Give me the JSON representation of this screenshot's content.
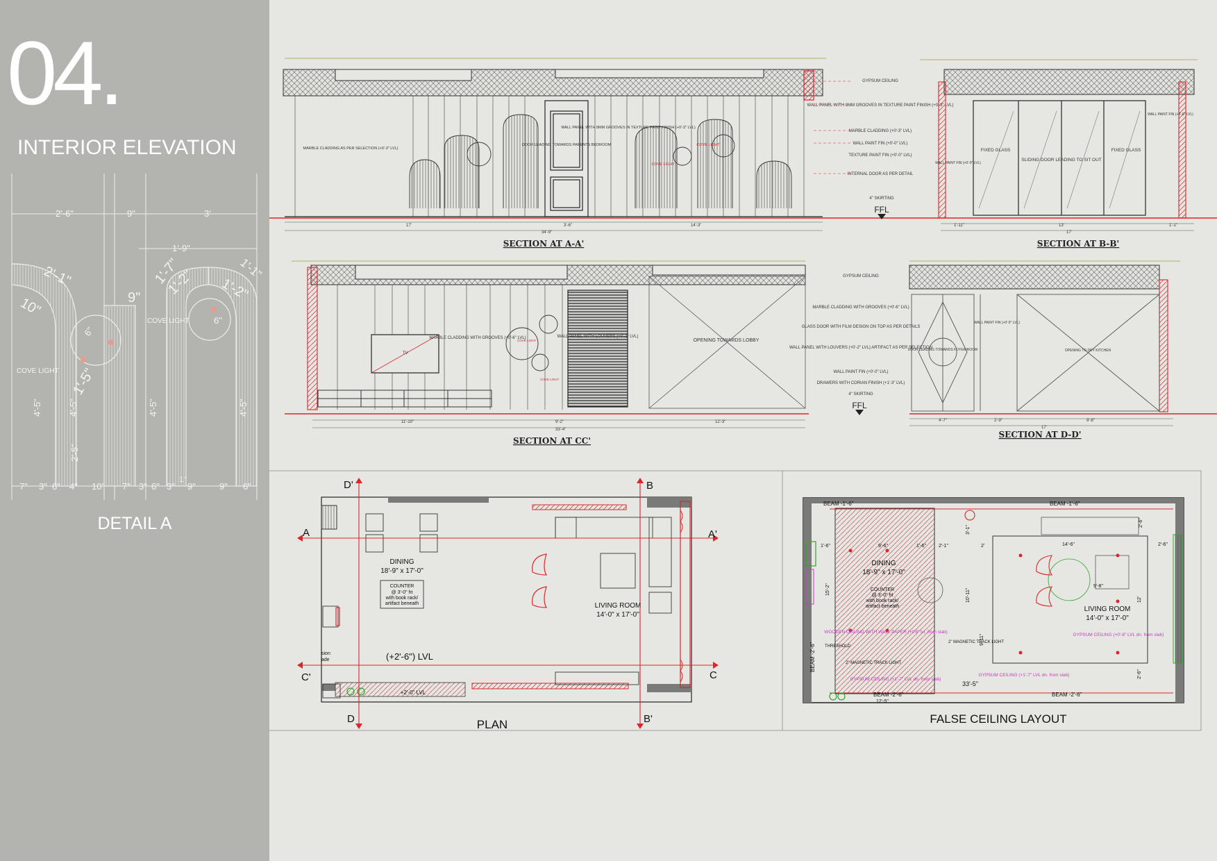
{
  "sheet": {
    "number": "04.",
    "title": "INTERIOR ELEVATION",
    "detail_title": "DETAIL A"
  },
  "detail_a": {
    "dims_top": [
      "2'-6\"",
      "9\"",
      "3'"
    ],
    "dims_radius": [
      "1'-9\"",
      "1'-1\"",
      "2'-1\"",
      "10\"",
      "9\"",
      "1'-7\"",
      "1'-2\"",
      "1'-2\"",
      "6\"",
      "6\"",
      "1'-5\""
    ],
    "dims_vertical": [
      "4'-5\"",
      "4'-5\"",
      "2'-5\"",
      "4'-5\"",
      "4'-5\""
    ],
    "dims_bottom": [
      "7\"",
      "3\"",
      "6\"",
      "4\"",
      "10\"",
      "7\"",
      "3\"",
      "6\"",
      "3\"",
      "9\"",
      "9\"",
      "6\"",
      "1\""
    ],
    "labels": [
      "COVE LIGHT",
      "COVE LIGHT"
    ]
  },
  "section_aa": {
    "caption": "SECTION AT A-A'",
    "notes": [
      "GYPSUM CEILING",
      "WALL PANEL WITH 8MM GROOVES IN TEXTURE PAINT FINISH (+0'-3\" LVL)",
      "MARBLE CLADDING (+0'-3\" LVL)",
      "WALL PAINT FIN (+0'-0\" LVL)",
      "TEXTURE PAINT FIN (+0'-0\" LVL)",
      "INTERNAL DOOR AS PER DETAIL",
      "4\" SKIRTING"
    ],
    "inner_labels": [
      "MARBLE CLADDING AS PER SELECTION (+0'-3\" LVL)",
      "DOOR LEADING TOWARDS PARENTS BEDROOM",
      "WALL PANEL WITH 8MM GROOVES IN TEXTURE PAINT FINISH (+0'-3\" LVL)",
      "COVE LIGHT",
      "COVE LIGHT"
    ],
    "ffl": "FFL",
    "dims_bottom": [
      "17'",
      "3'-6\"",
      "14'-3\"",
      "34'-9\""
    ]
  },
  "section_bb": {
    "caption": "SECTION AT B-B'",
    "labels": [
      "FIXED GLASS",
      "SLIDING DOOR LEADING TO SIT OUT",
      "FIXED GLASS",
      "WALL PAINT FIN (+0'-0\" LVL)",
      "WALL PAINT FIN (+0'-0\" LVL)"
    ],
    "dims_bottom": [
      "1'-11\"",
      "13'",
      "1'-1\"",
      "17'"
    ]
  },
  "section_cc": {
    "caption": "SECTION AT CC'",
    "notes": [
      "GYPSUM CEILING",
      "MARBLE CLADDING WITH GROOVES (+0'-6\" LVL)",
      "GLASS DOOR WITH FILM DESIGN ON TOP AS PER DETAILS",
      "WALL PANEL WITH LOUVERS (+0'-2\" LVL) ARTIFACT AS PER SELECTION",
      "WALL PAINT FIN (+0'-0\" LVL)",
      "DRAWERS WITH CORIAN FINISH (+1'-3\" LVL)",
      "4\" SKIRTING"
    ],
    "inner_labels": [
      "TV",
      "MARBLE CLADDING WITH GROOVES (+0'-6\" LVL)",
      "WALL PANEL WITH LOUVERS (+0'-2\" LVL)",
      "OPENING TOWARDS LOBBY",
      "COVE LIGHT",
      "COVE LIGHT"
    ],
    "ffl": "FFL",
    "dims_bottom": [
      "11'-10\"",
      "9'-2\"",
      "12'-3\"",
      "33'-4\""
    ]
  },
  "section_dd": {
    "caption": "SECTION AT D-D'",
    "labels": [
      "DOOR LEADING TOWARDS FOYER/ROOM",
      "WALL PAINT FIN (+0'-0\" LVL)",
      "OPENING TO DRY KITCHEN"
    ],
    "dims_bottom": [
      "4'-7\"",
      "2'-9\"",
      "9'-8\"",
      "17'"
    ]
  },
  "plan": {
    "caption": "PLAN",
    "markers": [
      "A",
      "A'",
      "B",
      "B'",
      "C",
      "C'",
      "D",
      "D'"
    ],
    "dining_name": "DINING",
    "dining_size": "18'-9\" x 17'-0\"",
    "counter": [
      "COUNTER",
      "@ 3'-0\" ht",
      "with book rack/",
      "artifact beneath"
    ],
    "living_name": "LIVING ROOM",
    "living_size": "14'-0\" x 17'-0\"",
    "level": "(+2'-6\") LVL",
    "level_small": "+2'-0\" LVL",
    "edge_text": [
      "sion",
      "ade"
    ]
  },
  "ceiling": {
    "caption": "FALSE CEILING LAYOUT",
    "beams": [
      "BEAM -1'-6\"",
      "BEAM -1'-6\"",
      "BEAM -2'-6\"",
      "BEAM -2'-6\"",
      "BEAM -2'-6\""
    ],
    "dining_name": "DINING",
    "dining_size": "18'-9\" x 17'-0\"",
    "counter": [
      "COUNTER",
      "@ 3'-0\" ht",
      "with book rack/",
      "artifact beneath"
    ],
    "living_name": "LIVING ROOM",
    "living_size": "14'-0\" x 17'-0\"",
    "notes": [
      "WOODEN CEILING WITH WALL PAPER (+0'8\" lvl. from slab)",
      "GYPSUM CEILING (+1'-7\" LVL dn. from slab)",
      "GYPSUM CEILING (+0'-8\" LVL dn. from slab)",
      "GYPSUM CEILING (+1'-7\" LVL dn. from slab)",
      "THRESHOLD",
      "2\" MAGNETIC TRACK LIGHT",
      "2\" MAGNETIC TRACK LIGHT"
    ],
    "dims": [
      "9'-6\"",
      "1'-6\"",
      "2'-1\"",
      "2'",
      "14'-6\"",
      "2'-6\"",
      "1'-6\"",
      "15'-2\"",
      "9'-11\"",
      "10'-11\"",
      "3'-1\"",
      "9'-8\"",
      "12'",
      "2'-6\"",
      "33'-5\"",
      "12'-5\"",
      "2'-6\""
    ]
  },
  "colors": {
    "sidebar": "#b3b3b0",
    "background": "#e6e6e2",
    "line": "#333333",
    "red": "#d9262b",
    "hatch": "#555555",
    "magenta": "#c040c0",
    "green": "#2fa52f"
  }
}
